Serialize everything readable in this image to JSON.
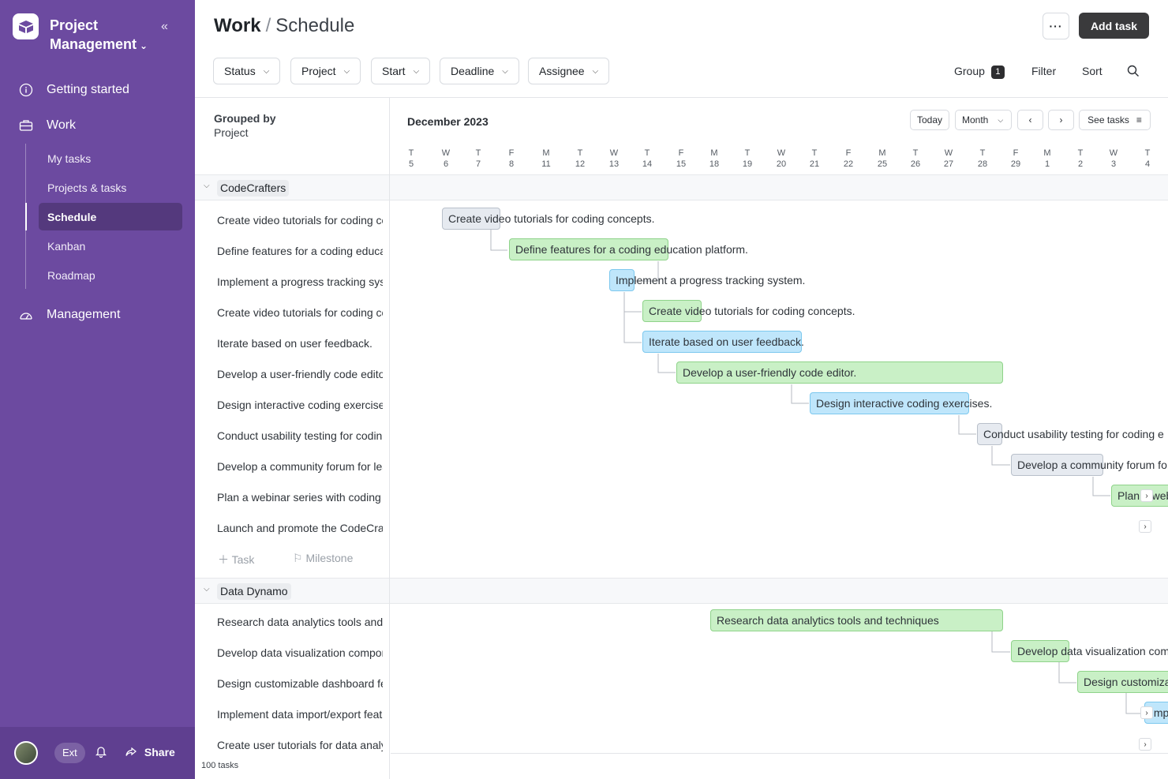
{
  "app": {
    "title_line1": "Project",
    "title_line2": "Management",
    "nav": {
      "getting_started": "Getting started",
      "work": "Work",
      "management": "Management"
    },
    "subnav": [
      "My tasks",
      "Projects & tasks",
      "Schedule",
      "Kanban",
      "Roadmap"
    ],
    "footer": {
      "ext": "Ext",
      "share": "Share"
    }
  },
  "header": {
    "breadcrumb_root": "Work",
    "breadcrumb_sep": "/",
    "breadcrumb_current": "Schedule",
    "more": "···",
    "add_task": "Add task"
  },
  "filters": [
    "Status",
    "Project",
    "Start",
    "Deadline",
    "Assignee"
  ],
  "toolbar": {
    "group": "Group",
    "group_count": "1",
    "filter": "Filter",
    "sort": "Sort"
  },
  "list": {
    "grouped_by_label": "Grouped by",
    "grouped_by_value": "Project",
    "add_task": "Task",
    "add_milestone": "Milestone",
    "task_count": "100 tasks",
    "groups": [
      {
        "name": "CodeCrafters",
        "tasks": [
          "Create video tutorials for coding concepts.",
          "Define features for a coding education platform.",
          "Implement a progress tracking system.",
          "Create video tutorials for coding concepts.",
          "Iterate based on user feedback.",
          "Develop a user-friendly code editor.",
          "Design interactive coding exercises.",
          "Conduct usability testing for coding exercises.",
          "Develop a community forum for learners.",
          "Plan a webinar series with coding experts.",
          "Launch and promote the CodeCrafters platform."
        ]
      },
      {
        "name": "Data Dynamo",
        "tasks": [
          "Research data analytics tools and techniques",
          "Develop data visualization components",
          "Design customizable dashboard features",
          "Implement data import/export features",
          "Create user tutorials for data analysis"
        ]
      }
    ]
  },
  "gantt": {
    "month": "December 2023",
    "buttons": {
      "today": "Today",
      "month": "Month",
      "prev": "‹",
      "next": "›",
      "see_tasks": "See tasks"
    },
    "days": [
      {
        "w": "T",
        "d": "5"
      },
      {
        "w": "W",
        "d": "6"
      },
      {
        "w": "T",
        "d": "7"
      },
      {
        "w": "F",
        "d": "8"
      },
      {
        "w": "M",
        "d": "11"
      },
      {
        "w": "T",
        "d": "12"
      },
      {
        "w": "W",
        "d": "13"
      },
      {
        "w": "T",
        "d": "14"
      },
      {
        "w": "F",
        "d": "15"
      },
      {
        "w": "M",
        "d": "18"
      },
      {
        "w": "T",
        "d": "19"
      },
      {
        "w": "W",
        "d": "20"
      },
      {
        "w": "T",
        "d": "21"
      },
      {
        "w": "F",
        "d": "22"
      },
      {
        "w": "M",
        "d": "25"
      },
      {
        "w": "T",
        "d": "26"
      },
      {
        "w": "W",
        "d": "27"
      },
      {
        "w": "T",
        "d": "28"
      },
      {
        "w": "F",
        "d": "29"
      },
      {
        "w": "M",
        "d": "1"
      },
      {
        "w": "T",
        "d": "2"
      },
      {
        "w": "W",
        "d": "3"
      },
      {
        "w": "T",
        "d": "4"
      }
    ],
    "bars": [
      "Create video tutorials for coding concepts.",
      "Define features for a coding education platform.",
      "Implement a progress tracking system.",
      "Create video tutorials for coding concepts.",
      "Iterate based on user feedback.",
      "Develop a user-friendly code editor.",
      "Design interactive coding exercises.",
      "Conduct usability testing for coding e",
      "Develop a community forum fo",
      "Plan a web",
      "Research data analytics tools and techniques",
      "Develop data visualization com",
      "Design customiza",
      "Imp"
    ]
  }
}
